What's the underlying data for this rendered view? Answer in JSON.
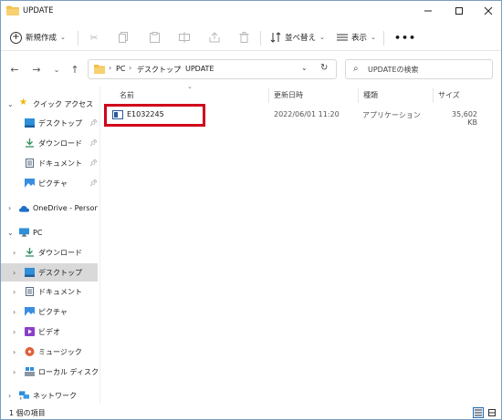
{
  "window": {
    "title": "UPDATE"
  },
  "toolbar": {
    "new_label": "新規作成",
    "sort_label": "並べ替え",
    "view_label": "表示",
    "more_label": "•••"
  },
  "address": {
    "crumbs": [
      "PC",
      "デスクトップ",
      "UPDATE"
    ]
  },
  "search": {
    "placeholder": "UPDATEの検索"
  },
  "sidebar": {
    "items": [
      {
        "label": "クイック アクセス"
      },
      {
        "label": "デスクトップ"
      },
      {
        "label": "ダウンロード"
      },
      {
        "label": "ドキュメント"
      },
      {
        "label": "ピクチャ"
      },
      {
        "label": "OneDrive - Personal"
      },
      {
        "label": "PC"
      },
      {
        "label": "ダウンロード"
      },
      {
        "label": "デスクトップ"
      },
      {
        "label": "ドキュメント"
      },
      {
        "label": "ピクチャ"
      },
      {
        "label": "ビデオ"
      },
      {
        "label": "ミュージック"
      },
      {
        "label": "ローカル ディスク (C:)"
      },
      {
        "label": "ネットワーク"
      }
    ]
  },
  "columns": {
    "name": "名前",
    "date": "更新日時",
    "type": "種類",
    "size": "サイズ"
  },
  "files": [
    {
      "name": "E1032245",
      "date": "2022/06/01 11:20",
      "type": "アプリケーション",
      "size": "35,602 KB"
    }
  ],
  "status": {
    "text": "1 個の項目"
  },
  "colors": {
    "accent": "#2a6fb8",
    "highlight": "#d0021b",
    "folder": "#f2c04a",
    "selected": "#d9d9d9"
  }
}
